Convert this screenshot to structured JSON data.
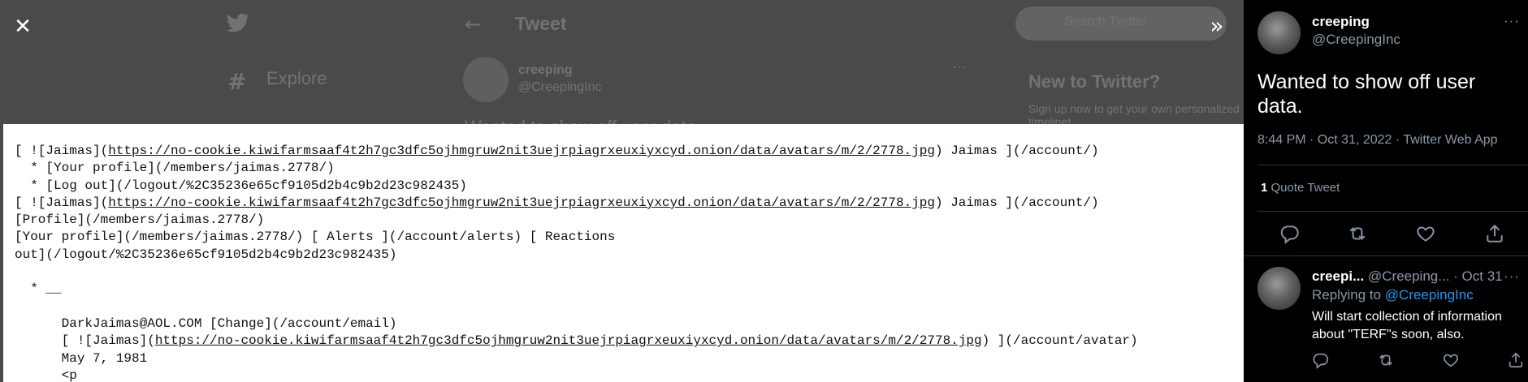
{
  "viewer": {
    "close_icon": "close-icon",
    "expand_icon": "chevron-double-right-icon",
    "image_lines": [
      {
        "a": "[ ![Jaimas](",
        "u": "https://no-cookie.kiwifarmsaaf4t2h7gc3dfc5ojhmgruw2nit3uejrpiagrxeuxiyxcyd.onion/data/avatars/m/2/2778.jpg",
        "b": ") Jaimas ](/account/)"
      },
      {
        "a": "  * [Your profile](/members/jaimas.2778/)"
      },
      {
        "a": "  * [Log out](/logout/%2C35236e65cf9105d2b4c9b2d23c982435)"
      },
      {
        "a": "[ ![Jaimas](",
        "u": "https://no-cookie.kiwifarmsaaf4t2h7gc3dfc5ojhmgruw2nit3uejrpiagrxeuxiyxcyd.onion/data/avatars/m/2/2778.jpg",
        "b": ") Jaimas ](/account/)"
      },
      {
        "a": "[Profile](/members/jaimas.2778/)"
      },
      {
        "a": "[Your profile](/members/jaimas.2778/) [ Alerts ](/account/alerts) [ Reactions"
      },
      {
        "a": "out](/logout/%2C35236e65cf9105d2b4c9b2d23c982435)"
      },
      {
        "a": ""
      },
      {
        "a": "  * __"
      },
      {
        "a": ""
      },
      {
        "a": "      DarkJaimas@AOL.COM [Change](/account/email)"
      },
      {
        "a": "      [ ![Jaimas](",
        "u": "https://no-cookie.kiwifarmsaaf4t2h7gc3dfc5ojhmgruw2nit3uejrpiagrxeuxiyxcyd.onion/data/avatars/m/2/2778.jpg",
        "b": ") ](/account/avatar)"
      },
      {
        "a": "      May 7, 1981"
      },
      {
        "a": "      <p"
      }
    ]
  },
  "background_page": {
    "explore_label": "Explore",
    "tweet_heading": "Tweet",
    "author_name": "creeping",
    "author_handle": "@CreepingInc",
    "search_placeholder": "Search Twitter",
    "new_heading": "New to Twitter?",
    "signup_text": "Sign up now to get your own personalized timeline!",
    "tweet_fragment": "Wanted to show off user data."
  },
  "tweet": {
    "author_name": "creeping",
    "author_handle": "@CreepingInc",
    "text": "Wanted to show off user data.",
    "timestamp": "8:44 PM · Oct 31, 2022 · Twitter Web App",
    "quote_count": "1",
    "quote_label": "Quote Tweet",
    "more_icon": "more-horizontal-icon"
  },
  "reply": {
    "author_name": "creepi...",
    "meta": "@Creeping... · Oct 31",
    "replying_prefix": "Replying to ",
    "replying_handle": "@CreepingInc",
    "text": "Will start collection of information about \"TERF\"s soon, also."
  },
  "icons": {
    "reply": "reply-icon",
    "retweet": "retweet-icon",
    "like": "heart-icon",
    "share": "share-icon"
  }
}
